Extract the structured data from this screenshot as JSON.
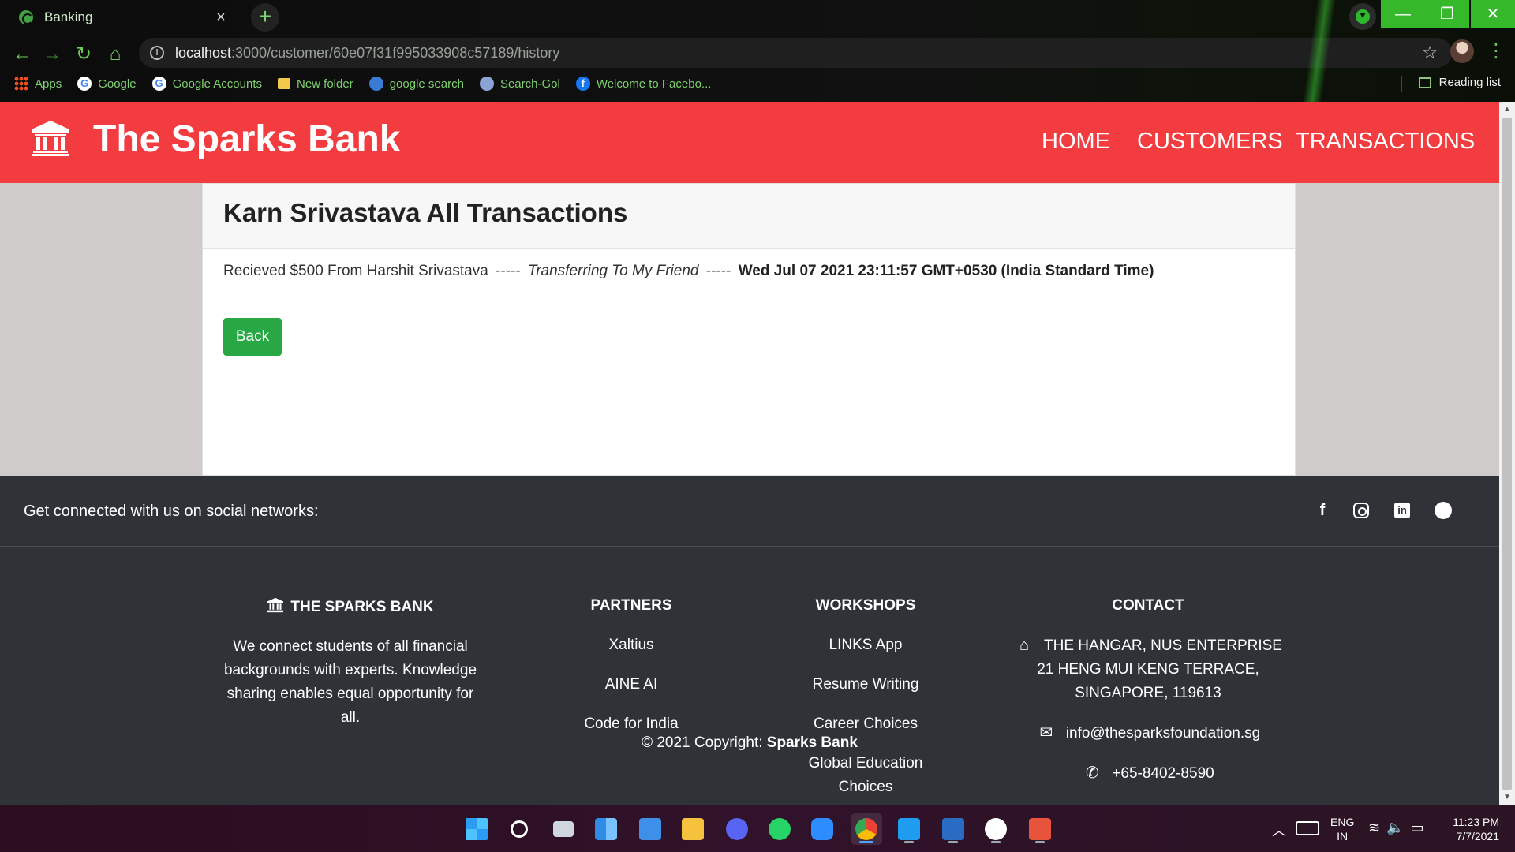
{
  "browser": {
    "tab_title": "Banking",
    "tab_close": "×",
    "new_tab": "+",
    "url_host": "localhost",
    "url_path": ":3000/customer/60e07f31f995033908c57189/history",
    "window_controls": {
      "minimize": "—",
      "maximize": "❐",
      "close": "✕"
    },
    "bookmarks": [
      {
        "label": "Apps",
        "icon": "apps-grid-icon"
      },
      {
        "label": "Google",
        "icon": "google-icon"
      },
      {
        "label": "Google Accounts",
        "icon": "google-icon"
      },
      {
        "label": "New folder",
        "icon": "folder-icon"
      },
      {
        "label": "google search",
        "icon": "globe-icon"
      },
      {
        "label": "Search-Gol",
        "icon": "search-gol-icon"
      },
      {
        "label": "Welcome to Facebo...",
        "icon": "facebook-icon"
      }
    ],
    "reading_list": "Reading list"
  },
  "site": {
    "brand": "The Sparks Bank",
    "nav": {
      "home": "HOME",
      "customers": "CUSTOMERS",
      "transactions": "TRANSACTIONS"
    },
    "colors": {
      "header": "#f23c3f",
      "back_button": "#28a745",
      "footer": "#2f3338"
    }
  },
  "history": {
    "title": "Karn Srivastava All Transactions",
    "transactions": [
      {
        "summary": "Recieved $500 From Harshit Srivastava",
        "separator": "-----",
        "note": "Transferring To My Friend",
        "timestamp": "Wed Jul 07 2021 23:11:57 GMT+0530 (India Standard Time)"
      }
    ],
    "back_label": "Back"
  },
  "footer": {
    "social_text": "Get connected with us on social networks:",
    "social_icons": [
      "facebook-icon",
      "instagram-icon",
      "linkedin-icon",
      "github-icon"
    ],
    "bank": {
      "heading": "THE SPARKS BANK",
      "text": "We connect students of all financial backgrounds with experts. Knowledge sharing enables equal opportunity for all."
    },
    "partners": {
      "heading": "PARTNERS",
      "items": [
        "Xaltius",
        "AINE AI",
        "Code for India"
      ]
    },
    "workshops": {
      "heading": "WORKSHOPS",
      "items": [
        "LINKS App",
        "Resume Writing",
        "Career Choices",
        "Global Education Choices"
      ]
    },
    "contact": {
      "heading": "CONTACT",
      "address": "THE HANGAR, NUS ENTERPRISE 21 HENG MUI KENG TERRACE, SINGAPORE, 119613",
      "email": "info@thesparksfoundation.sg",
      "phone": "+65-8402-8590"
    },
    "copyright_prefix": "© 2021 Copyright: ",
    "copyright_brand": "Sparks Bank"
  },
  "taskbar": {
    "lang_top": "ENG",
    "lang_bottom": "IN",
    "time": "11:23 PM",
    "date": "7/7/2021",
    "apps": [
      "windows-start-icon",
      "search-icon",
      "task-view-icon",
      "widgets-icon",
      "mail-icon",
      "file-explorer-icon",
      "discord-icon",
      "whatsapp-icon",
      "zoom-icon",
      "chrome-icon",
      "vscode-icon",
      "powershell-icon",
      "mongodb-compass-icon",
      "office-icon"
    ]
  }
}
